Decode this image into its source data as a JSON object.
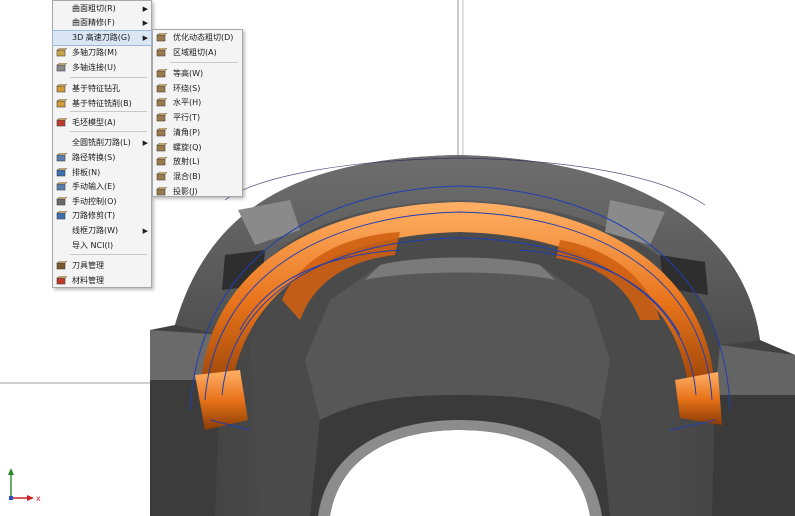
{
  "main_menu": {
    "items": [
      {
        "label": "曲面粗切(R)",
        "submenu": true,
        "icon": "none"
      },
      {
        "label": "曲面精修(F)",
        "submenu": true,
        "icon": "none"
      },
      {
        "label": "3D 高速刀路(G)",
        "submenu": true,
        "icon": "none",
        "highlighted": true
      },
      {
        "label": "多轴刀路(M)",
        "submenu": false,
        "icon": "multiaxis-toolpath-icon"
      },
      {
        "label": "多轴连接(U)",
        "submenu": false,
        "icon": "multiaxis-link-icon"
      },
      {
        "label": "基于特征钻孔",
        "submenu": false,
        "icon": "feature-drill-icon"
      },
      {
        "label": "基于特征铣削(B)",
        "submenu": false,
        "icon": "feature-mill-icon"
      },
      {
        "label": "毛坯模型(A)",
        "submenu": false,
        "icon": "stock-model-icon"
      },
      {
        "label": "全圆铣削刀路(L)",
        "submenu": true,
        "icon": "none"
      },
      {
        "label": "路径转换(S)",
        "submenu": false,
        "icon": "path-transform-icon"
      },
      {
        "label": "排板(N)",
        "submenu": false,
        "icon": "nesting-icon"
      },
      {
        "label": "手动输入(E)",
        "submenu": false,
        "icon": "manual-entry-icon"
      },
      {
        "label": "手动控制(O)",
        "submenu": false,
        "icon": "manual-control-icon"
      },
      {
        "label": "刀路修剪(T)",
        "submenu": false,
        "icon": "toolpath-trim-icon"
      },
      {
        "label": "线框刀路(W)",
        "submenu": true,
        "icon": "none"
      },
      {
        "label": "导入 NCI(I)",
        "submenu": false,
        "icon": "none"
      },
      {
        "label": "刀具管理",
        "submenu": false,
        "icon": "tool-manager-icon"
      },
      {
        "label": "材料管理",
        "submenu": false,
        "icon": "material-manager-icon"
      }
    ]
  },
  "sub_menu": {
    "items": [
      {
        "label": "优化动态粗切(D)",
        "icon": "dynamic-roughing-icon"
      },
      {
        "label": "区域粗切(A)",
        "icon": "area-roughing-icon"
      },
      {
        "label": "等高(W)",
        "icon": "waterline-icon"
      },
      {
        "label": "环绕(S)",
        "icon": "scallop-icon"
      },
      {
        "label": "水平(H)",
        "icon": "horizontal-icon"
      },
      {
        "label": "平行(T)",
        "icon": "raster-icon"
      },
      {
        "label": "清角(P)",
        "icon": "pencil-icon"
      },
      {
        "label": "螺旋(Q)",
        "icon": "spiral-icon"
      },
      {
        "label": "放射(L)",
        "icon": "radial-icon"
      },
      {
        "label": "混合(B)",
        "icon": "hybrid-icon"
      },
      {
        "label": "投影(J)",
        "icon": "project-icon"
      }
    ]
  },
  "axis": {
    "x_label": "x"
  },
  "colors": {
    "toolpath_orange": "#e8731a",
    "model_gray": "#5a5a5a",
    "wire_blue": "#1f3fb0",
    "menu_bg": "#f4f4f4",
    "highlight": "#dbe6f4"
  }
}
